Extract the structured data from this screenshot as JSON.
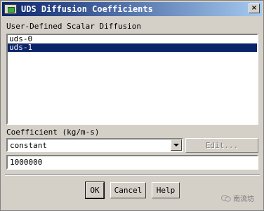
{
  "window": {
    "title": "UDS Diffusion Coefficients",
    "close_symbol": "×"
  },
  "list_label": "User-Defined Scalar Diffusion",
  "list_items": [
    {
      "label": "uds-0",
      "selected": false
    },
    {
      "label": "uds-1",
      "selected": true
    }
  ],
  "coefficient_label": "Coefficient (kg/m-s)",
  "method_select": {
    "value": "constant"
  },
  "edit_button": {
    "label": "Edit..."
  },
  "value_field": {
    "value": "1000000"
  },
  "buttons": {
    "ok": "OK",
    "cancel": "Cancel",
    "help": "Help"
  },
  "watermark": {
    "text": "南流坊"
  },
  "colors": {
    "title_start": "#0a246a",
    "title_end": "#a6caf0",
    "selection": "#0a246a",
    "face": "#d4d0c8"
  }
}
